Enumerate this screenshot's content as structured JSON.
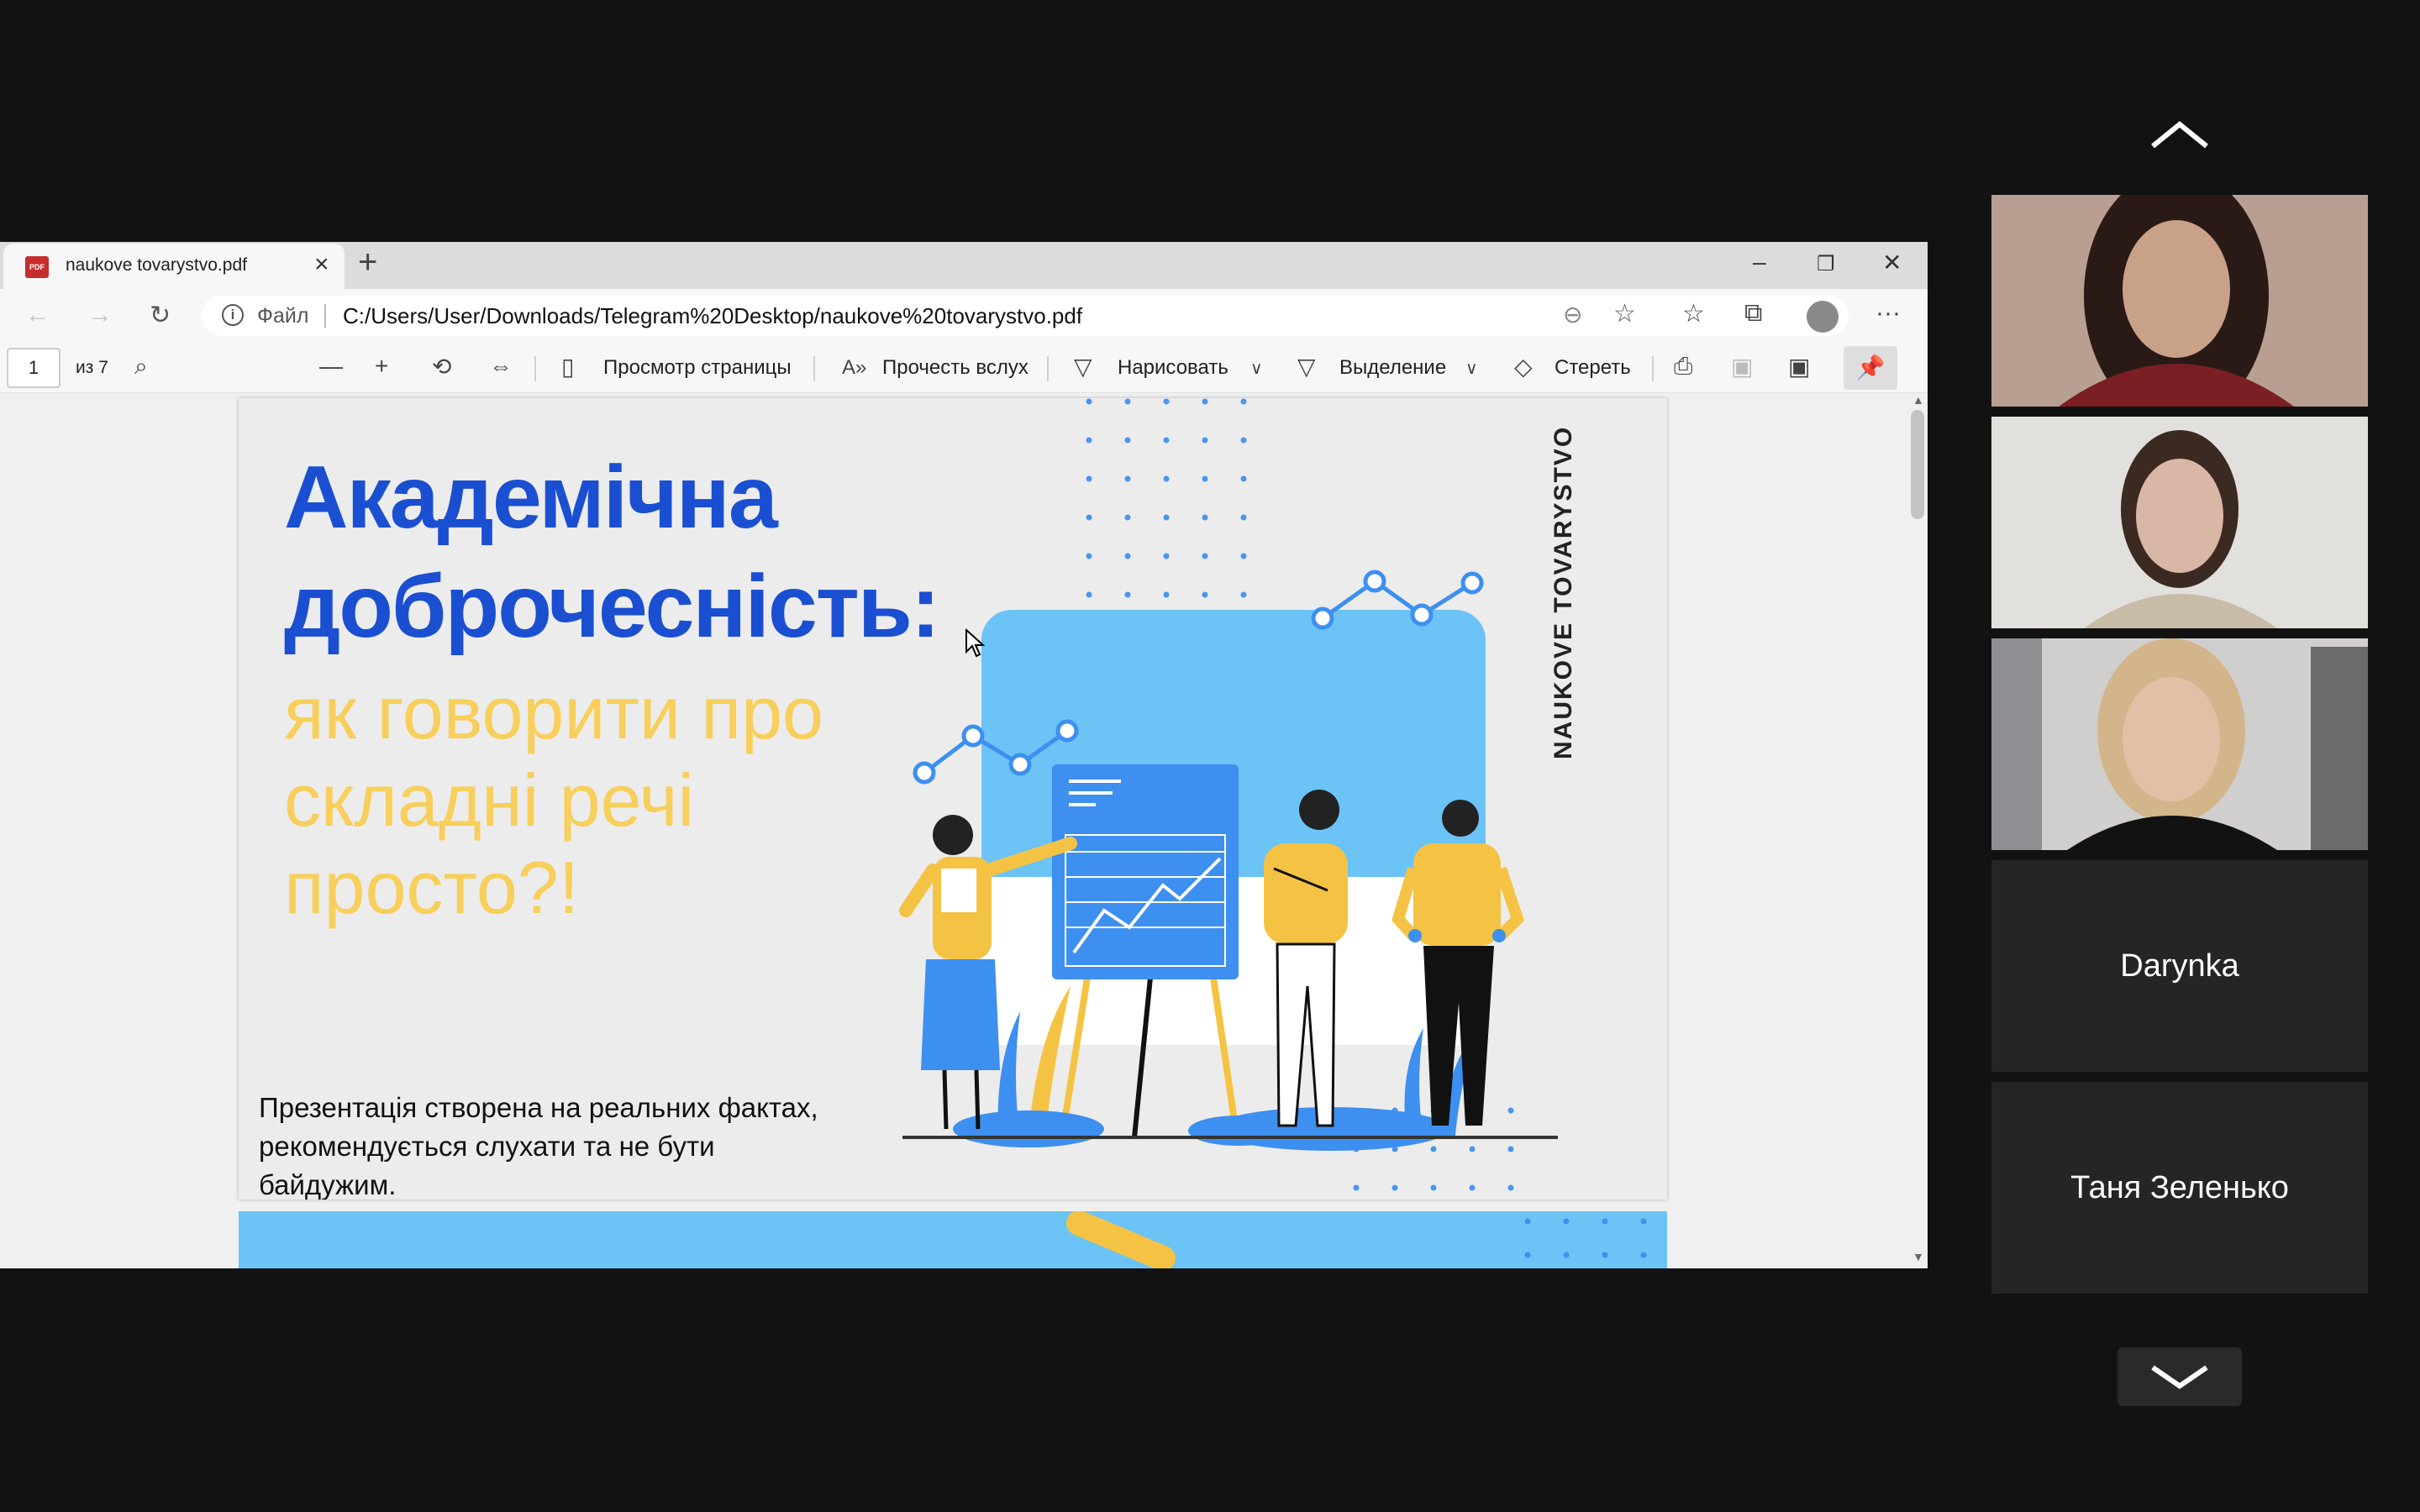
{
  "browser": {
    "tab_title": "naukove tovarystvo.pdf",
    "favicon_text": "PDF",
    "file_label": "Файл",
    "url": "C:/Users/User/Downloads/Telegram%20Desktop/naukove%20tovarystvo.pdf"
  },
  "pdf_toolbar": {
    "page_number": "1",
    "page_count": "из 7",
    "page_view": "Просмотр страницы",
    "read_aloud": "Прочесть вслух",
    "draw": "Нарисовать",
    "highlight": "Выделение",
    "erase": "Стереть"
  },
  "slide": {
    "title_line1": "Академічна",
    "title_line2": "доброчесність:",
    "subtitle_lines": [
      "як говорити про",
      "складні речі",
      "просто?!"
    ],
    "vertical_text": "NAUKOVE  TOVARYSTVO",
    "description_lines": [
      "Презентація створена на реальних фактах,",
      "рекомендується слухати та не бути",
      "байдужим."
    ]
  },
  "participants": [
    {
      "type": "video",
      "skin": "#c9a189",
      "hair": "#2a1a16",
      "bg": "#b89f92",
      "shirt": "#7a1f24"
    },
    {
      "type": "video",
      "skin": "#d8b8a4",
      "hair": "#3b2a22",
      "bg": "#e2e0dc",
      "shirt": "#c9bca7"
    },
    {
      "type": "video",
      "skin": "#e2c0a8",
      "hair": "#d2b58a",
      "bg": "#d0cfcd",
      "shirt": "#121212"
    },
    {
      "type": "name",
      "name": "Darynka"
    },
    {
      "type": "name",
      "name": "Таня Зеленько"
    }
  ],
  "colors": {
    "title_blue": "#1a4fd1",
    "subtitle_yellow": "#f7cf5a",
    "light_blue": "#6cc3f5",
    "figure_yellow": "#f5c343",
    "figure_blue": "#3d8ff0"
  }
}
